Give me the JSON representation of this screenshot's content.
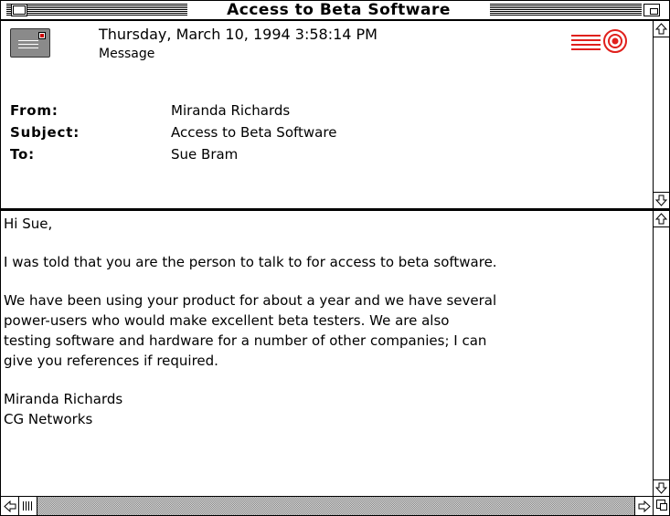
{
  "window": {
    "title": "Access to Beta Software"
  },
  "header": {
    "date": "Thursday, March 10, 1994 3:58:14 PM",
    "kind": "Message",
    "fields": [
      {
        "label": "From:",
        "value": "Miranda Richards"
      },
      {
        "label": "Subject:",
        "value": "Access to Beta Software"
      },
      {
        "label": "To:",
        "value": "Sue Bram"
      }
    ],
    "icons": {
      "message": "letter-icon",
      "stamp": "postmark-stamp-icon"
    }
  },
  "body": {
    "greeting": "Hi Sue,",
    "lines": [
      "I was told that you are the person to talk to for access to beta software.",
      "We have been using your product for about a year and we have several",
      "power-users who would make excellent beta testers. We are also",
      "testing software and hardware for a number of other companies; I can",
      "give you references if required."
    ],
    "signature": [
      "Miranda Richards",
      "CG Networks"
    ]
  },
  "colors": {
    "stamp_red": "#e0201c",
    "scroll_track": "#bfbfbf"
  }
}
